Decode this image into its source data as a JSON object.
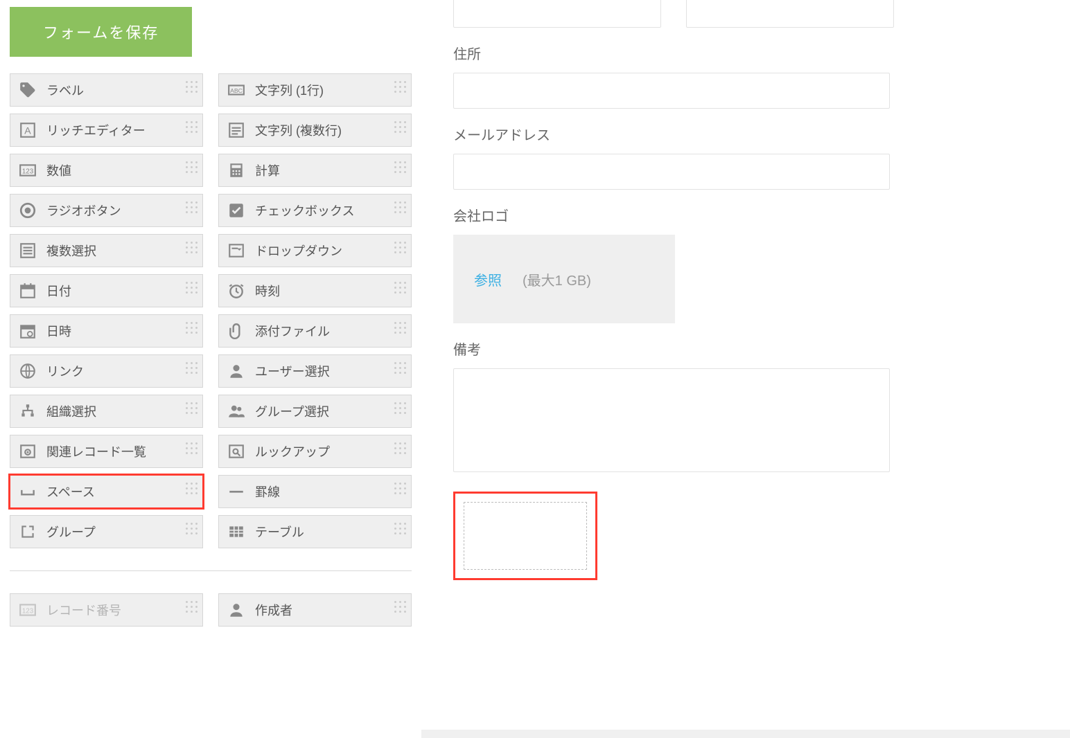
{
  "sidebar": {
    "save_label": "フォームを保存",
    "left_items": [
      {
        "id": "label",
        "label": "ラベル",
        "icon": "tag-icon"
      },
      {
        "id": "rich",
        "label": "リッチエディター",
        "icon": "rich-icon"
      },
      {
        "id": "number",
        "label": "数値",
        "icon": "num-icon"
      },
      {
        "id": "radio",
        "label": "ラジオボタン",
        "icon": "radio-icon"
      },
      {
        "id": "multiselect",
        "label": "複数選択",
        "icon": "multi-icon"
      },
      {
        "id": "date",
        "label": "日付",
        "icon": "date-icon"
      },
      {
        "id": "datetime",
        "label": "日時",
        "icon": "datetime-icon"
      },
      {
        "id": "link",
        "label": "リンク",
        "icon": "globe-icon"
      },
      {
        "id": "org",
        "label": "組織選択",
        "icon": "org-icon"
      },
      {
        "id": "related",
        "label": "関連レコード一覧",
        "icon": "related-icon"
      },
      {
        "id": "space",
        "label": "スペース",
        "icon": "space-icon",
        "highlight": true
      },
      {
        "id": "group",
        "label": "グループ",
        "icon": "groupbox-icon"
      }
    ],
    "right_items": [
      {
        "id": "text1",
        "label": "文字列 (1行)",
        "icon": "abc-icon"
      },
      {
        "id": "textm",
        "label": "文字列 (複数行)",
        "icon": "lines-icon"
      },
      {
        "id": "calc",
        "label": "計算",
        "icon": "calc-icon"
      },
      {
        "id": "check",
        "label": "チェックボックス",
        "icon": "check-icon"
      },
      {
        "id": "drop",
        "label": "ドロップダウン",
        "icon": "drop-icon"
      },
      {
        "id": "time",
        "label": "時刻",
        "icon": "clock-icon"
      },
      {
        "id": "attach",
        "label": "添付ファイル",
        "icon": "clip-icon"
      },
      {
        "id": "user",
        "label": "ユーザー選択",
        "icon": "user-icon"
      },
      {
        "id": "groupsel",
        "label": "グループ選択",
        "icon": "groupsel-icon"
      },
      {
        "id": "lookup",
        "label": "ルックアップ",
        "icon": "lookup-icon"
      },
      {
        "id": "border",
        "label": "罫線",
        "icon": "hr-icon"
      },
      {
        "id": "table",
        "label": "テーブル",
        "icon": "table-icon"
      }
    ],
    "builtin_left": [
      {
        "id": "recno",
        "label": "レコード番号",
        "icon": "num-icon",
        "disabled": true
      }
    ],
    "builtin_right": [
      {
        "id": "creator",
        "label": "作成者",
        "icon": "user-icon"
      }
    ]
  },
  "form": {
    "address_label": "住所",
    "email_label": "メールアドレス",
    "logo_label": "会社ロゴ",
    "logo_browse": "参照",
    "logo_hint": "(最大1 GB)",
    "memo_label": "備考"
  }
}
